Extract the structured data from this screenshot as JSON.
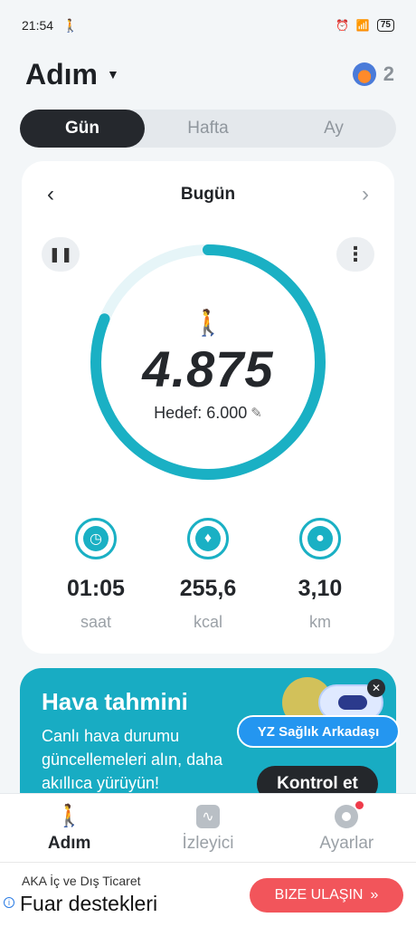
{
  "status_bar": {
    "time": "21:54",
    "battery": "75"
  },
  "header": {
    "title": "Adım",
    "streak_count": "2"
  },
  "tabs": [
    {
      "label": "Gün"
    },
    {
      "label": "Hafta"
    },
    {
      "label": "Ay"
    }
  ],
  "day_card": {
    "date_label": "Bugün",
    "steps": "4.875",
    "goal_text": "Hedef: 6.000",
    "goal_progress": 0.8125,
    "stats": [
      {
        "value": "01:05",
        "unit": "saat"
      },
      {
        "value": "255,6",
        "unit": "kcal"
      },
      {
        "value": "3,10",
        "unit": "km"
      }
    ]
  },
  "weather_card": {
    "title": "Hava tahmini",
    "text": "Canlı hava durumu güncellemeleri alın, daha akıllıca yürüyün!",
    "button": "Kontrol et"
  },
  "ai_assistant": {
    "label": "YZ Sağlık Arkadaşı"
  },
  "bottom_nav": [
    {
      "label": "Adım"
    },
    {
      "label": "İzleyici"
    },
    {
      "label": "Ayarlar"
    }
  ],
  "ad": {
    "advertiser": "AKA İç ve Dış Ticaret",
    "headline": "Fuar destekleri",
    "button": "BIZE ULAŞIN"
  },
  "colors": {
    "accent": "#1ab0c4",
    "dark": "#24272b",
    "weather_bg": "#18acc3",
    "ad_button": "#f2555b"
  }
}
